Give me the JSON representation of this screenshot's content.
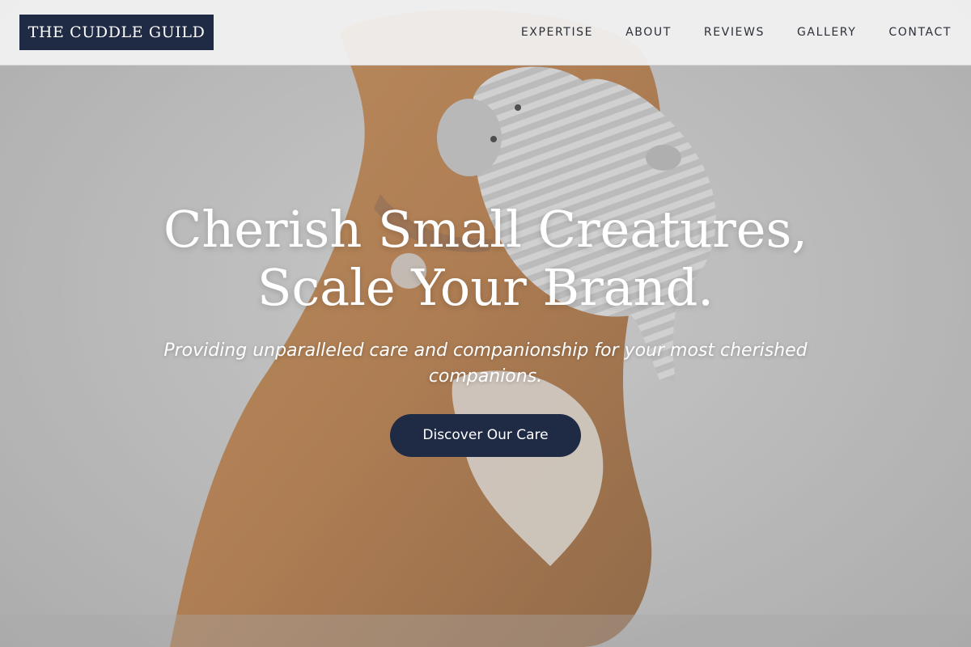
{
  "header": {
    "logo_text": "THE CUDDLE GUILD",
    "nav": [
      {
        "label": "EXPERTISE"
      },
      {
        "label": "ABOUT"
      },
      {
        "label": "REVIEWS"
      },
      {
        "label": "GALLERY"
      },
      {
        "label": "CONTACT"
      }
    ]
  },
  "hero": {
    "title_line1": "Cherish Small Creatures,",
    "title_line2": "Scale Your Brand.",
    "subtitle": "Providing unparalleled care and companionship for your most cherished companions.",
    "cta_label": "Discover Our Care",
    "background_image": "dog-with-knitted-elephant-toy"
  },
  "colors": {
    "brand_navy": "#1f2a44",
    "header_bg": "#f2f2f2",
    "nav_text": "#2b2f38",
    "hero_text": "#ffffff"
  }
}
